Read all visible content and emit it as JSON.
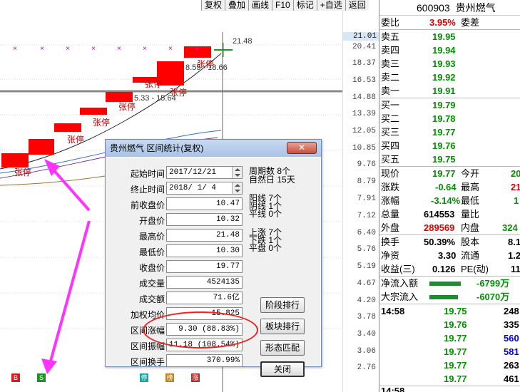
{
  "toolbar": [
    "复权",
    "叠加",
    "画线",
    "F10",
    "标记",
    "+自选",
    "返回"
  ],
  "chart": {
    "current_price_marker": "21.01",
    "price_ticks": [
      "20.41",
      "18.37",
      "16.53",
      "14.88",
      "13.39",
      "12.05",
      "10.85",
      "9.76",
      "8.79",
      "7.91",
      "7.12",
      "6.40",
      "5.76",
      "5.19",
      "4.67",
      "4.20",
      "3.78",
      "3.40",
      "3.06",
      "2.76"
    ],
    "limit_up_label": "张停",
    "range_labels": [
      "21.48",
      "8.55 - 18.66",
      "5.33 - 15.64"
    ],
    "bottom_markers": [
      "B",
      "S",
      "停",
      "榜",
      "涨"
    ]
  },
  "quote": {
    "code": "600903",
    "name": "贵州燃气",
    "weibi_label": "委比",
    "weibi_value": "3.95%",
    "weicha_label": "委差",
    "sells": [
      {
        "label": "卖五",
        "price": "19.95"
      },
      {
        "label": "卖四",
        "price": "19.94"
      },
      {
        "label": "卖三",
        "price": "19.93"
      },
      {
        "label": "卖二",
        "price": "19.92"
      },
      {
        "label": "卖一",
        "price": "19.91"
      }
    ],
    "buys": [
      {
        "label": "买一",
        "price": "19.79"
      },
      {
        "label": "买二",
        "price": "19.78"
      },
      {
        "label": "买三",
        "price": "19.77"
      },
      {
        "label": "买四",
        "price": "19.76"
      },
      {
        "label": "买五",
        "price": "19.75"
      }
    ],
    "stats": [
      {
        "l1": "现价",
        "v1": "19.77",
        "c1": "green",
        "l2": "今开",
        "v2": "20",
        "c2": "green"
      },
      {
        "l1": "涨跌",
        "v1": "-0.64",
        "c1": "green",
        "l2": "最高",
        "v2": "21",
        "c2": "red"
      },
      {
        "l1": "涨幅",
        "v1": "-3.14%",
        "c1": "green",
        "l2": "最低",
        "v2": "1",
        "c2": "green"
      },
      {
        "l1": "总量",
        "v1": "614553",
        "c1": "black",
        "l2": "量比",
        "v2": "",
        "c2": "black"
      },
      {
        "l1": "外盘",
        "v1": "289569",
        "c1": "red",
        "l2": "内盘",
        "v2": "324",
        "c2": "green"
      }
    ],
    "stats2": [
      {
        "l1": "换手",
        "v1": "50.39%",
        "l2": "股本",
        "v2": "8.1"
      },
      {
        "l1": "净资",
        "v1": "3.30",
        "l2": "流通",
        "v2": "1.2"
      },
      {
        "l1": "收益(三)",
        "v1": "0.126",
        "l2": "PE(动)",
        "v2": "11"
      }
    ],
    "flows": [
      {
        "label": "净流入额",
        "value": "-6799万"
      },
      {
        "label": "大宗流入",
        "value": "-6070万"
      }
    ],
    "ticks": [
      {
        "time": "14:58",
        "price": "19.75",
        "vol": "248",
        "vc": "black"
      },
      {
        "time": "",
        "price": "19.76",
        "vol": "335",
        "vc": "black"
      },
      {
        "time": "",
        "price": "19.77",
        "vol": "560",
        "vc": "blue"
      },
      {
        "time": "",
        "price": "19.77",
        "vol": "581",
        "vc": "blue"
      },
      {
        "time": "",
        "price": "19.77",
        "vol": "263",
        "vc": "black"
      },
      {
        "time": "",
        "price": "19.77",
        "vol": "461",
        "vc": "black"
      }
    ],
    "bottom_time": "14:58"
  },
  "dialog": {
    "title": "贵州燃气 区间统计(复权)",
    "close_label": "关闭",
    "fields": [
      {
        "label": "起始时间",
        "value": "2017/12/21"
      },
      {
        "label": "终止时间",
        "value": "2018/ 1/ 4"
      },
      {
        "label": "前收盘价",
        "value": "10.47"
      },
      {
        "label": "开盘价",
        "value": "10.32"
      },
      {
        "label": "最高价",
        "value": "21.48"
      },
      {
        "label": "最低价",
        "value": "10.30"
      },
      {
        "label": "收盘价",
        "value": "19.77"
      },
      {
        "label": "成交量",
        "value": "4524135"
      },
      {
        "label": "成交额",
        "value": "71.6亿"
      },
      {
        "label": "加权均价",
        "value": "15.825"
      },
      {
        "label": "区间涨幅",
        "value": "9.30 (88.83%)"
      },
      {
        "label": "区间振幅",
        "value": "11.18 (108.54%)"
      },
      {
        "label": "区间换手",
        "value": "370.99%"
      }
    ],
    "period_label": "周期数",
    "period_value": "8个",
    "natural_label": "自然日",
    "natural_value": "15天",
    "yang_label": "阳线",
    "yang_value": "7个",
    "yin_label": "阴线",
    "yin_value": "1个",
    "ping_label": "平线",
    "ping_value": "0个",
    "up_label": "上涨",
    "up_value": "7个",
    "down_label": "下跌",
    "down_value": "1个",
    "flat_label": "平盘",
    "flat_value": "0个",
    "buttons": [
      "阶段排行",
      "板块排行",
      "形态匹配"
    ],
    "ok_label": "关闭"
  }
}
